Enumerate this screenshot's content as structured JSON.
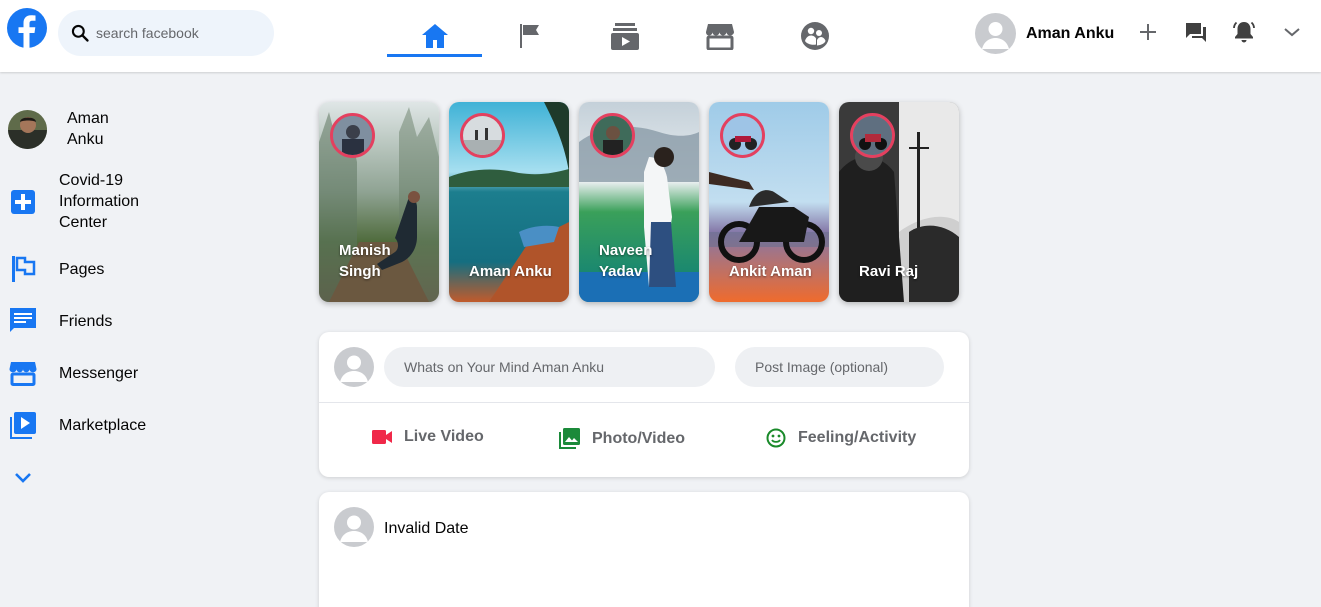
{
  "colors": {
    "brand": "#1877f2",
    "story_ring": "#e4405f",
    "live": "#f02849",
    "photo": "#45bd62",
    "feeling": "#2a9d3a"
  },
  "header": {
    "search": {
      "placeholder": "search facebook"
    },
    "nav_tabs": [
      {
        "name": "home",
        "icon": "home-icon",
        "active": true
      },
      {
        "name": "pages",
        "icon": "flag-icon",
        "active": false
      },
      {
        "name": "watch",
        "icon": "video-icon",
        "active": false
      },
      {
        "name": "marketplace",
        "icon": "store-icon",
        "active": false
      },
      {
        "name": "groups",
        "icon": "groups-icon",
        "active": false
      }
    ],
    "user_name": "Aman Anku",
    "actions": [
      "plus-icon",
      "chat-icon",
      "bell-icon",
      "chevron-down-icon"
    ]
  },
  "sidebar": {
    "profile_name": "Aman Anku",
    "items": [
      {
        "label": "Covid-19 Information Center",
        "icon": "plus-box-icon"
      },
      {
        "label": "Pages",
        "icon": "flag-icon"
      },
      {
        "label": "Friends",
        "icon": "chat-icon"
      },
      {
        "label": "Messenger",
        "icon": "store-icon"
      },
      {
        "label": "Marketplace",
        "icon": "video-library-icon"
      }
    ],
    "more_icon": "chevron-down-icon"
  },
  "stories": [
    {
      "name": "Manish Singh"
    },
    {
      "name": "Aman Anku"
    },
    {
      "name": "Naveen Yadav"
    },
    {
      "name": "Ankit Aman"
    },
    {
      "name": "Ravi Raj"
    }
  ],
  "composer": {
    "text_placeholder": "Whats on Your Mind Aman Anku",
    "image_placeholder": "Post Image (optional)",
    "actions": [
      {
        "label": "Live Video",
        "icon": "videocam-icon"
      },
      {
        "label": "Photo/Video",
        "icon": "photo-library-icon"
      },
      {
        "label": "Feeling/Activity",
        "icon": "smiley-icon"
      }
    ]
  },
  "post": {
    "date": "Invalid Date"
  }
}
